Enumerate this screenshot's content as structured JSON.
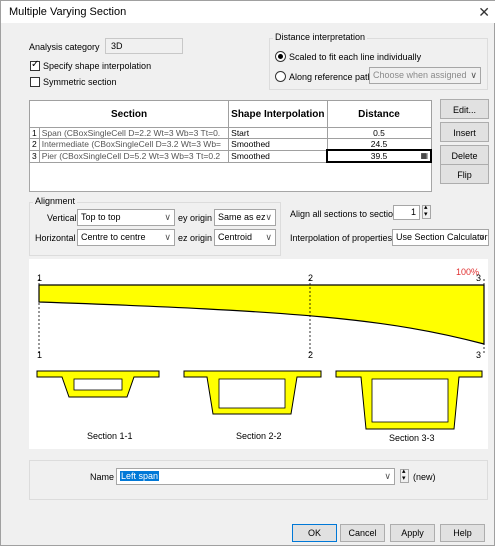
{
  "window": {
    "title": "Multiple Varying Section"
  },
  "analysis": {
    "label": "Analysis category",
    "value": "3D"
  },
  "options": {
    "specify_shape": "Specify shape interpolation",
    "symmetric": "Symmetric section"
  },
  "distance": {
    "group_title": "Distance interpretation",
    "scaled": "Scaled to fit each line individually",
    "along": "Along reference path",
    "ref_placeholder": "Choose when assigned"
  },
  "table": {
    "headers": {
      "section": "Section",
      "shape": "Shape Interpolation",
      "distance": "Distance"
    },
    "rows": [
      {
        "index": "1",
        "section": "Span (CBoxSingleCell D=2.2 Wt=3 Wb=3 Tt=0.",
        "shape": "Start",
        "distance": "0.5"
      },
      {
        "index": "2",
        "section": "Intermediate (CBoxSingleCell D=3.2 Wt=3 Wb=",
        "shape": "Smoothed",
        "distance": "24.5"
      },
      {
        "index": "3",
        "section": "Pier (CBoxSingleCell D=5.2 Wt=3 Wb=3 Tt=0.2",
        "shape": "Smoothed",
        "distance": "39.5"
      }
    ]
  },
  "buttons": {
    "edit": "Edit...",
    "insert": "Insert",
    "delete": "Delete",
    "flip": "Flip",
    "ok": "OK",
    "cancel": "Cancel",
    "apply": "Apply",
    "help": "Help"
  },
  "alignment": {
    "group_title": "Alignment",
    "vertical_label": "Vertical",
    "vertical_value": "Top to top",
    "horizontal_label": "Horizontal",
    "horizontal_value": "Centre to centre",
    "ey_label": "ey origin",
    "ey_value": "Same as ez",
    "ez_label": "ez origin",
    "ez_value": "Centroid",
    "align_all_label": "Align all sections to section",
    "align_all_value": "1",
    "interp_label": "Interpolation of properties",
    "interp_value": "Use Section Calculator"
  },
  "preview": {
    "percent": "100%",
    "markers_top": [
      "1",
      "2",
      "3"
    ],
    "markers_bottom": [
      "1",
      "2",
      "3"
    ],
    "section_labels": [
      "Section 1-1",
      "Section 2-2",
      "Section 3-3"
    ],
    "colors": {
      "fill": "#ffff00",
      "stroke": "#000000",
      "percent": "#e03030"
    }
  },
  "name": {
    "label": "Name",
    "value": "Left span",
    "status": "(new)"
  }
}
